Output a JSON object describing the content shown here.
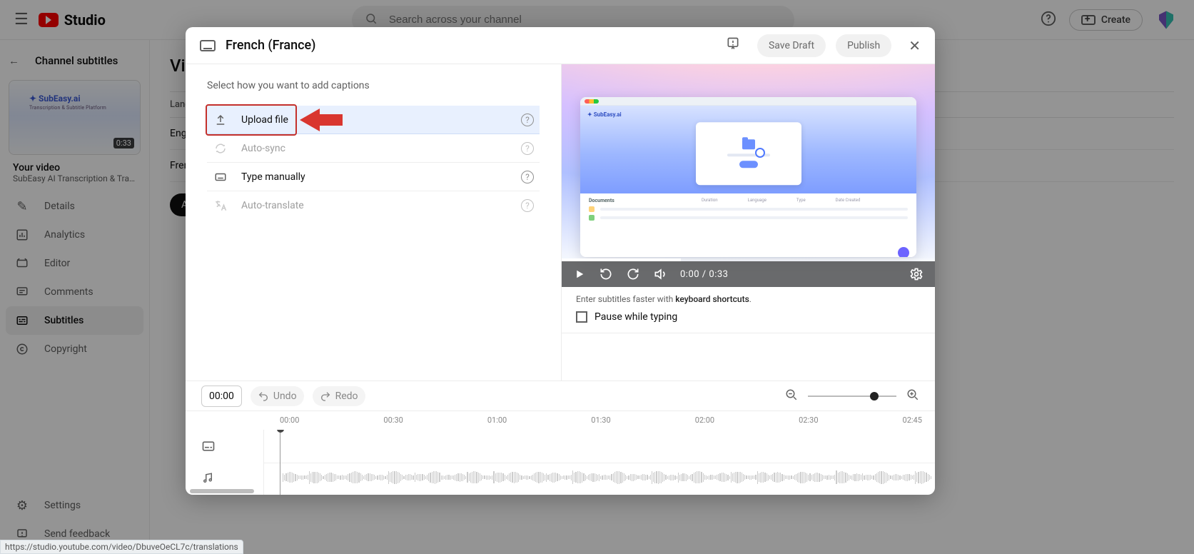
{
  "header": {
    "studio_label": "Studio",
    "search_placeholder": "Search across your channel",
    "create_label": "Create"
  },
  "sidebar": {
    "back_label": "Channel subtitles",
    "video_duration": "0:33",
    "thumb_brand": "SubEasy.ai",
    "thumb_tag": "Transcription & Subtitle Platform",
    "video_title": "Your video",
    "video_desc": "SubEasy AI Transcription & Translati...",
    "items": [
      {
        "icon": "pencil",
        "label": "Details"
      },
      {
        "icon": "analytics",
        "label": "Analytics"
      },
      {
        "icon": "editor",
        "label": "Editor"
      },
      {
        "icon": "comments",
        "label": "Comments"
      },
      {
        "icon": "subtitles",
        "label": "Subtitles",
        "active": true
      },
      {
        "icon": "copyright",
        "label": "Copyright"
      }
    ],
    "bottom": [
      {
        "icon": "gear",
        "label": "Settings"
      },
      {
        "icon": "feedback",
        "label": "Send feedback"
      }
    ]
  },
  "content": {
    "page_title": "Vi",
    "language_header": "Language",
    "rows": [
      "English",
      "French"
    ],
    "add_label": "Add"
  },
  "modal": {
    "language_title": "French (France)",
    "save_draft": "Save Draft",
    "publish": "Publish",
    "select_prompt": "Select how you want to add captions",
    "options": {
      "upload": "Upload file",
      "autosync": "Auto-sync",
      "type": "Type manually",
      "autotranslate": "Auto-translate"
    },
    "hint_prefix": "Enter subtitles faster with ",
    "hint_bold": "keyboard shortcuts",
    "hint_suffix": ".",
    "pause_label": "Pause while typing",
    "timecode": "00:00",
    "undo": "Undo",
    "redo": "Redo",
    "player_time_current": "0:00",
    "player_time_separator": " / ",
    "player_time_total": "0:33",
    "time_labels": [
      "00:00",
      "00:30",
      "01:00",
      "01:30",
      "02:00",
      "02:30",
      "02:45"
    ]
  },
  "status_url": "https://studio.youtube.com/video/DbuveOeCL7c/translations"
}
